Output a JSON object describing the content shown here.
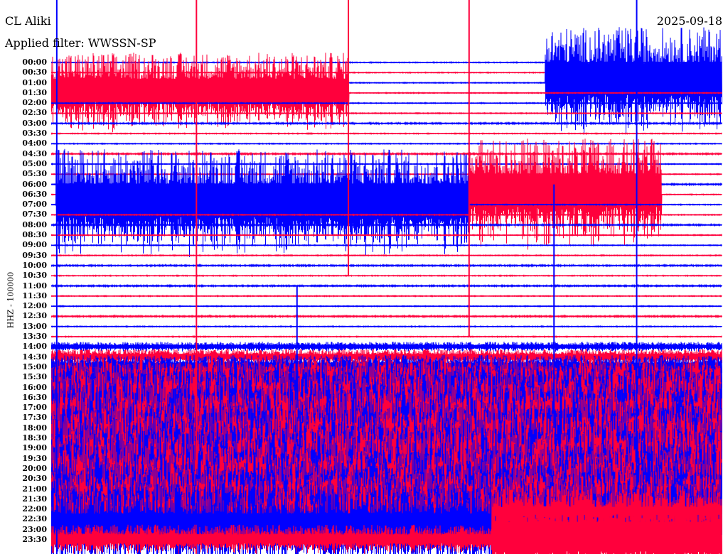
{
  "header": {
    "station": "CL Aliki",
    "filter": "Applied filter: WWSSN-SP",
    "date": "2025-09-18"
  },
  "chart_data": {
    "type": "line",
    "title": "CL Aliki",
    "subtitle": "Applied filter: WWSSN-SP",
    "date": "2025-09-18",
    "ylabel": "HHZ - 100000",
    "xlabel": "",
    "row_duration_min": 30,
    "colors": {
      "even": "#0000ff",
      "odd": "#ff003c"
    },
    "rows": [
      "00:00",
      "00:30",
      "01:00",
      "01:30",
      "02:00",
      "02:30",
      "03:00",
      "03:30",
      "04:00",
      "04:30",
      "05:00",
      "05:30",
      "06:00",
      "06:30",
      "07:00",
      "07:30",
      "08:00",
      "08:30",
      "09:00",
      "09:30",
      "10:00",
      "10:30",
      "11:00",
      "11:30",
      "12:00",
      "12:30",
      "13:00",
      "13:30",
      "14:00",
      "14:30",
      "15:00",
      "15:30",
      "16:00",
      "16:30",
      "17:00",
      "17:30",
      "18:00",
      "18:30",
      "19:00",
      "19:30",
      "20:00",
      "20:30",
      "21:00",
      "21:30",
      "22:00",
      "22:30",
      "23:00",
      "23:30"
    ],
    "base_amplitude_rows": [
      0.05,
      0.05,
      0.05,
      0.05,
      0.05,
      0.05,
      0.08,
      0.05,
      0.05,
      0.08,
      0.05,
      0.05,
      0.08,
      0.05,
      0.05,
      0.05,
      0.08,
      0.05,
      0.05,
      0.05,
      0.08,
      0.05,
      0.08,
      0.05,
      0.05,
      0.08,
      0.05,
      0.05,
      0.5,
      0.8,
      1.2,
      2.0,
      3.0,
      3.5,
      3.8,
      4.0,
      4.0,
      4.0,
      4.0,
      4.0,
      4.0,
      4.0,
      3.8,
      3.5,
      3.5,
      3.5,
      1.5,
      1.5
    ],
    "episodes": [
      {
        "row": "01:30",
        "start_min": 0,
        "end_min": 13.3,
        "amplitude_rows": 4.0
      },
      {
        "row": "01:00",
        "start_min": 22.1,
        "end_min": 30,
        "amplitude_rows": 5.5
      },
      {
        "row": "07:00",
        "start_min": 0.2,
        "end_min": 18.7,
        "amplitude_rows": 5.5
      },
      {
        "row": "06:30",
        "start_min": 18.7,
        "end_min": 27.3,
        "amplitude_rows": 5.5
      },
      {
        "row": "23:00",
        "start_min": 0,
        "end_min": 19.7,
        "amplitude_rows": 4.5
      },
      {
        "row": "23:30",
        "start_min": 19.7,
        "end_min": 30,
        "amplitude_rows": 5.0
      }
    ],
    "spikes": [
      {
        "row": "00:00",
        "min": 0.25,
        "amplitude_rows": 60
      },
      {
        "row": "07:30",
        "min": 6.5,
        "amplitude_rows": 25
      },
      {
        "row": "00:30",
        "min": 13.3,
        "amplitude_rows": 20
      },
      {
        "row": "04:30",
        "min": 18.7,
        "amplitude_rows": 18
      },
      {
        "row": "06:00",
        "min": 26.2,
        "amplitude_rows": 30
      },
      {
        "row": "12:00",
        "min": 22.5,
        "amplitude_rows": 12
      },
      {
        "row": "14:00",
        "min": 11.0,
        "amplitude_rows": 6
      }
    ]
  }
}
